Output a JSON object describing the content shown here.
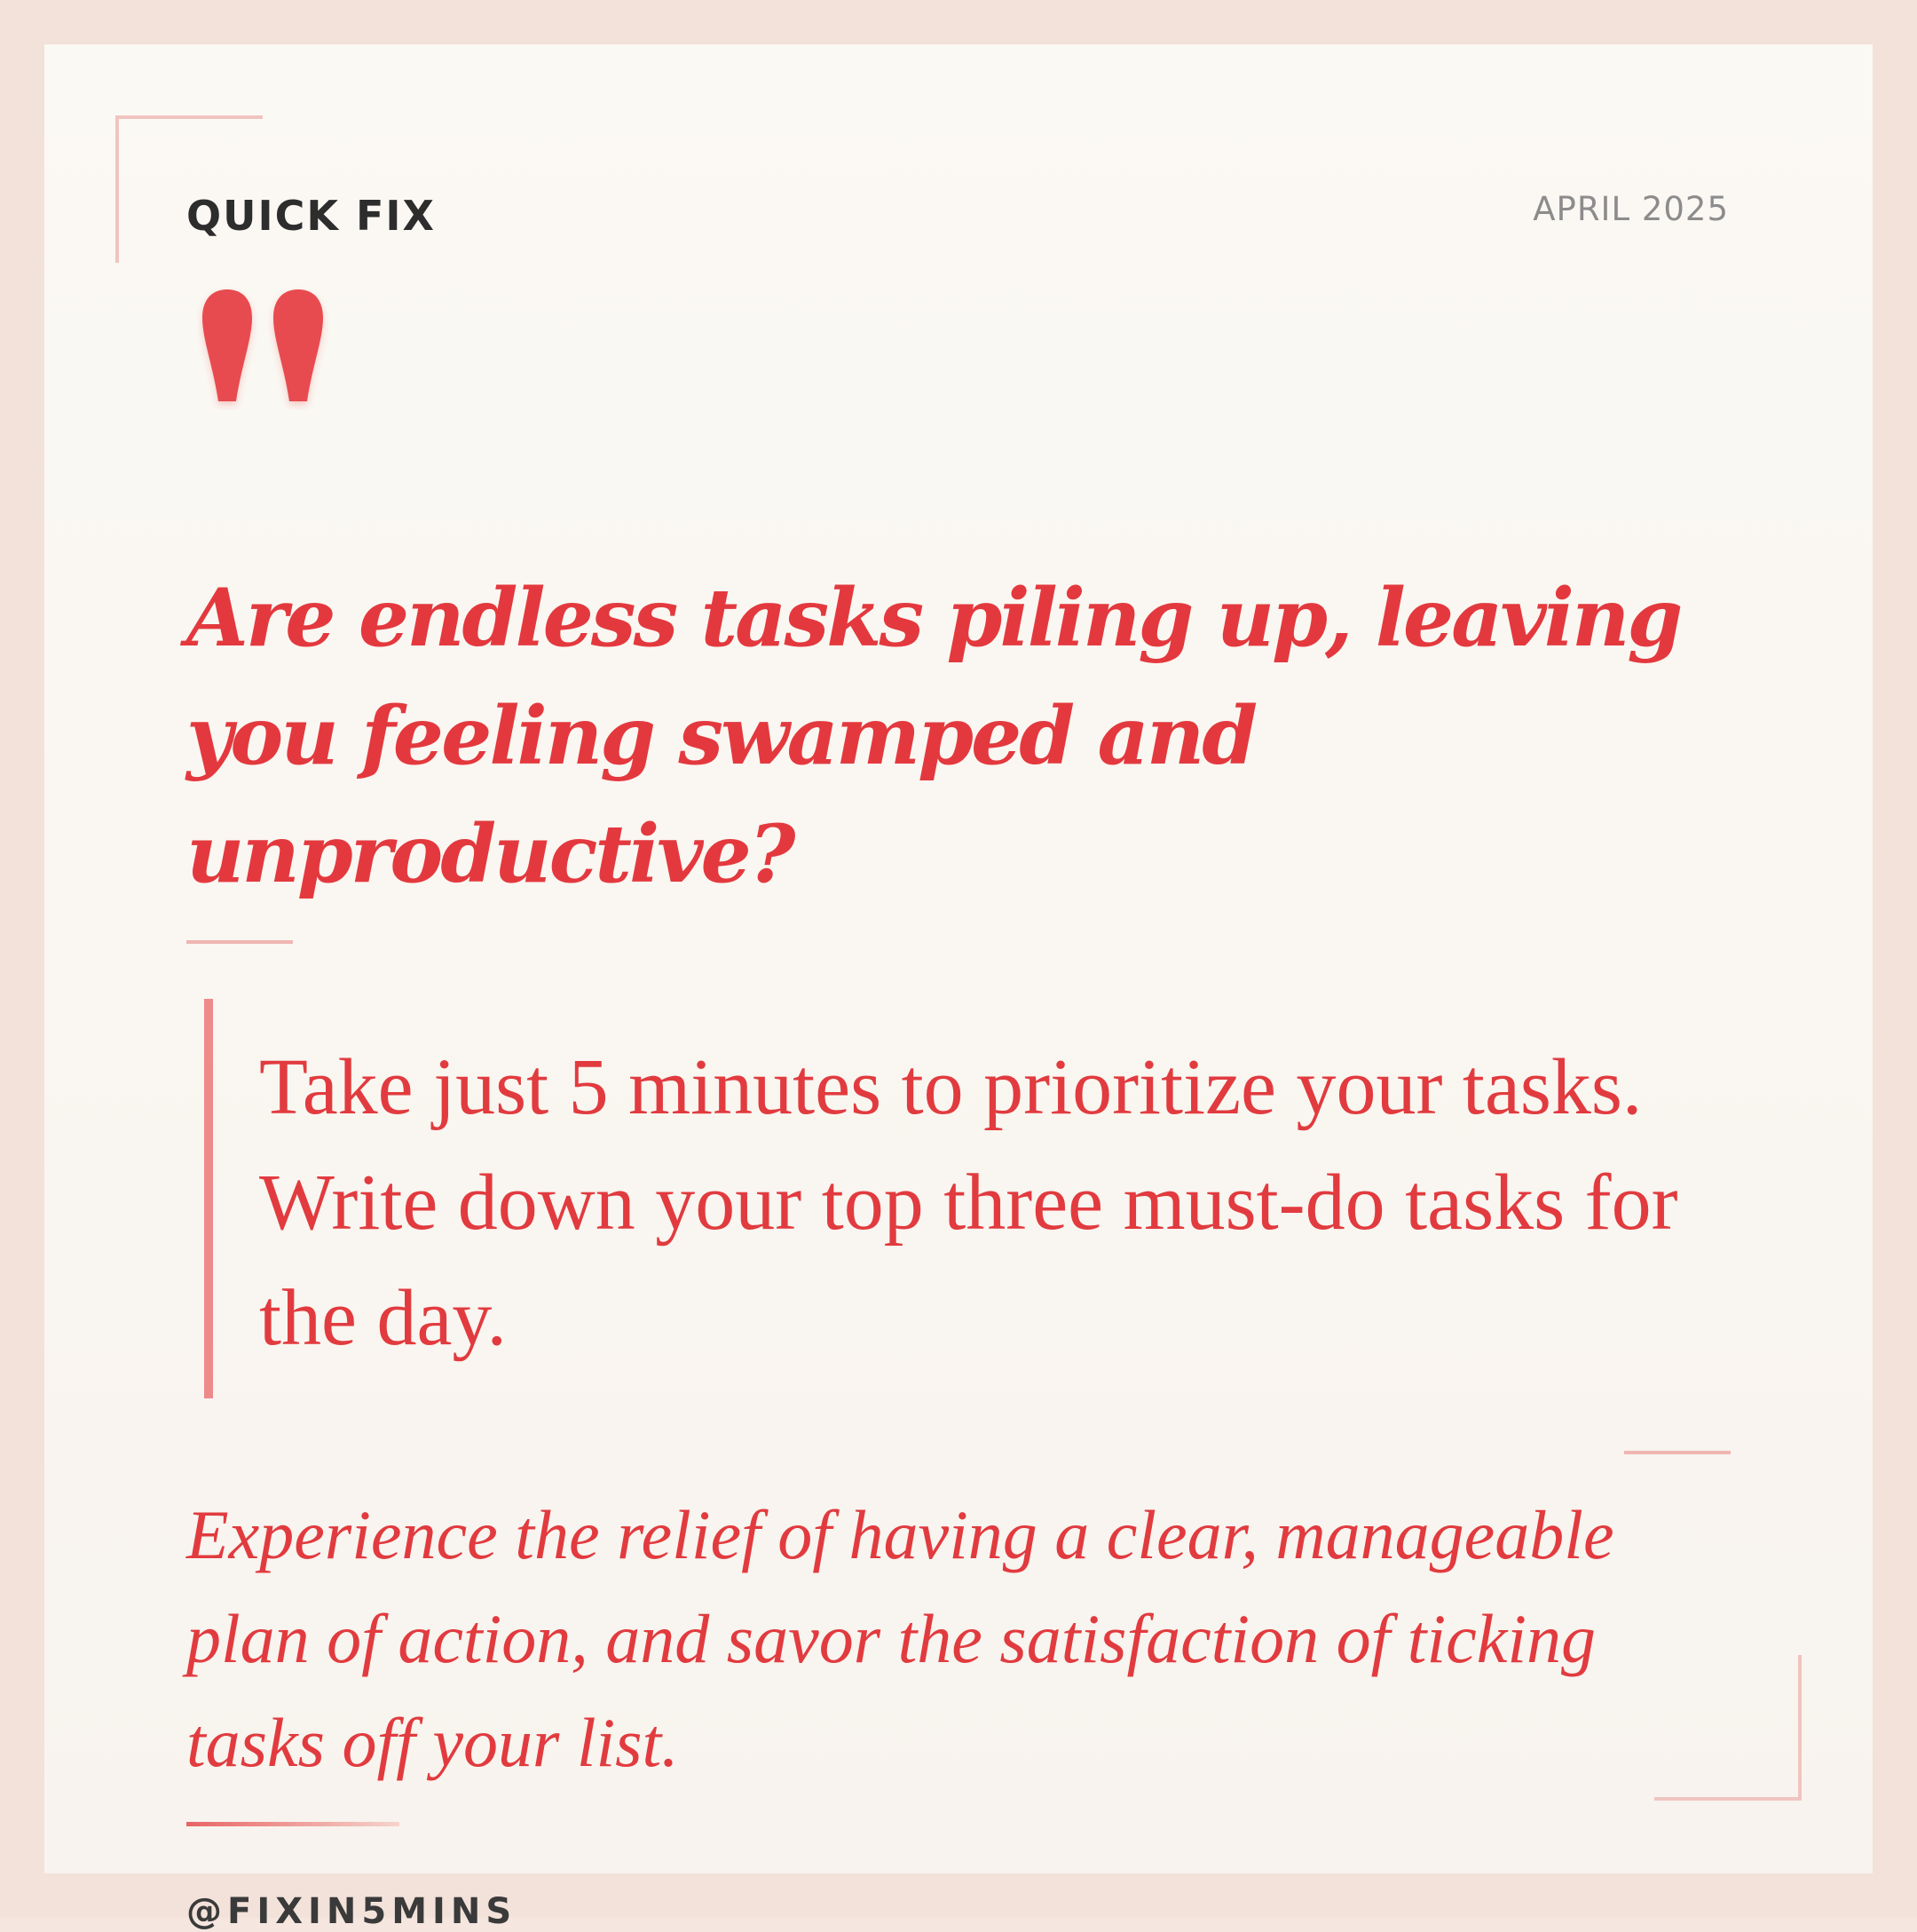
{
  "header": {
    "category": "QUICK FIX",
    "date": "APRIL 2025"
  },
  "quote_icon": "quotation-mark-icon",
  "headline": "Are endless tasks piling up, leaving you feeling swamped and unproductive?",
  "tip": "Take just 5 minutes to prioritize your tasks. Write down your top three must-do tasks for the day.",
  "benefit": "Experience the relief of having a clear, manageable plan of action, and savor the satisfaction of ticking tasks off your list.",
  "footer": {
    "handle": "@FIXIN5MINS"
  },
  "colors": {
    "accent": "#e3393e",
    "accent_light": "#f0c4c0",
    "background": "#fbf9f4"
  }
}
